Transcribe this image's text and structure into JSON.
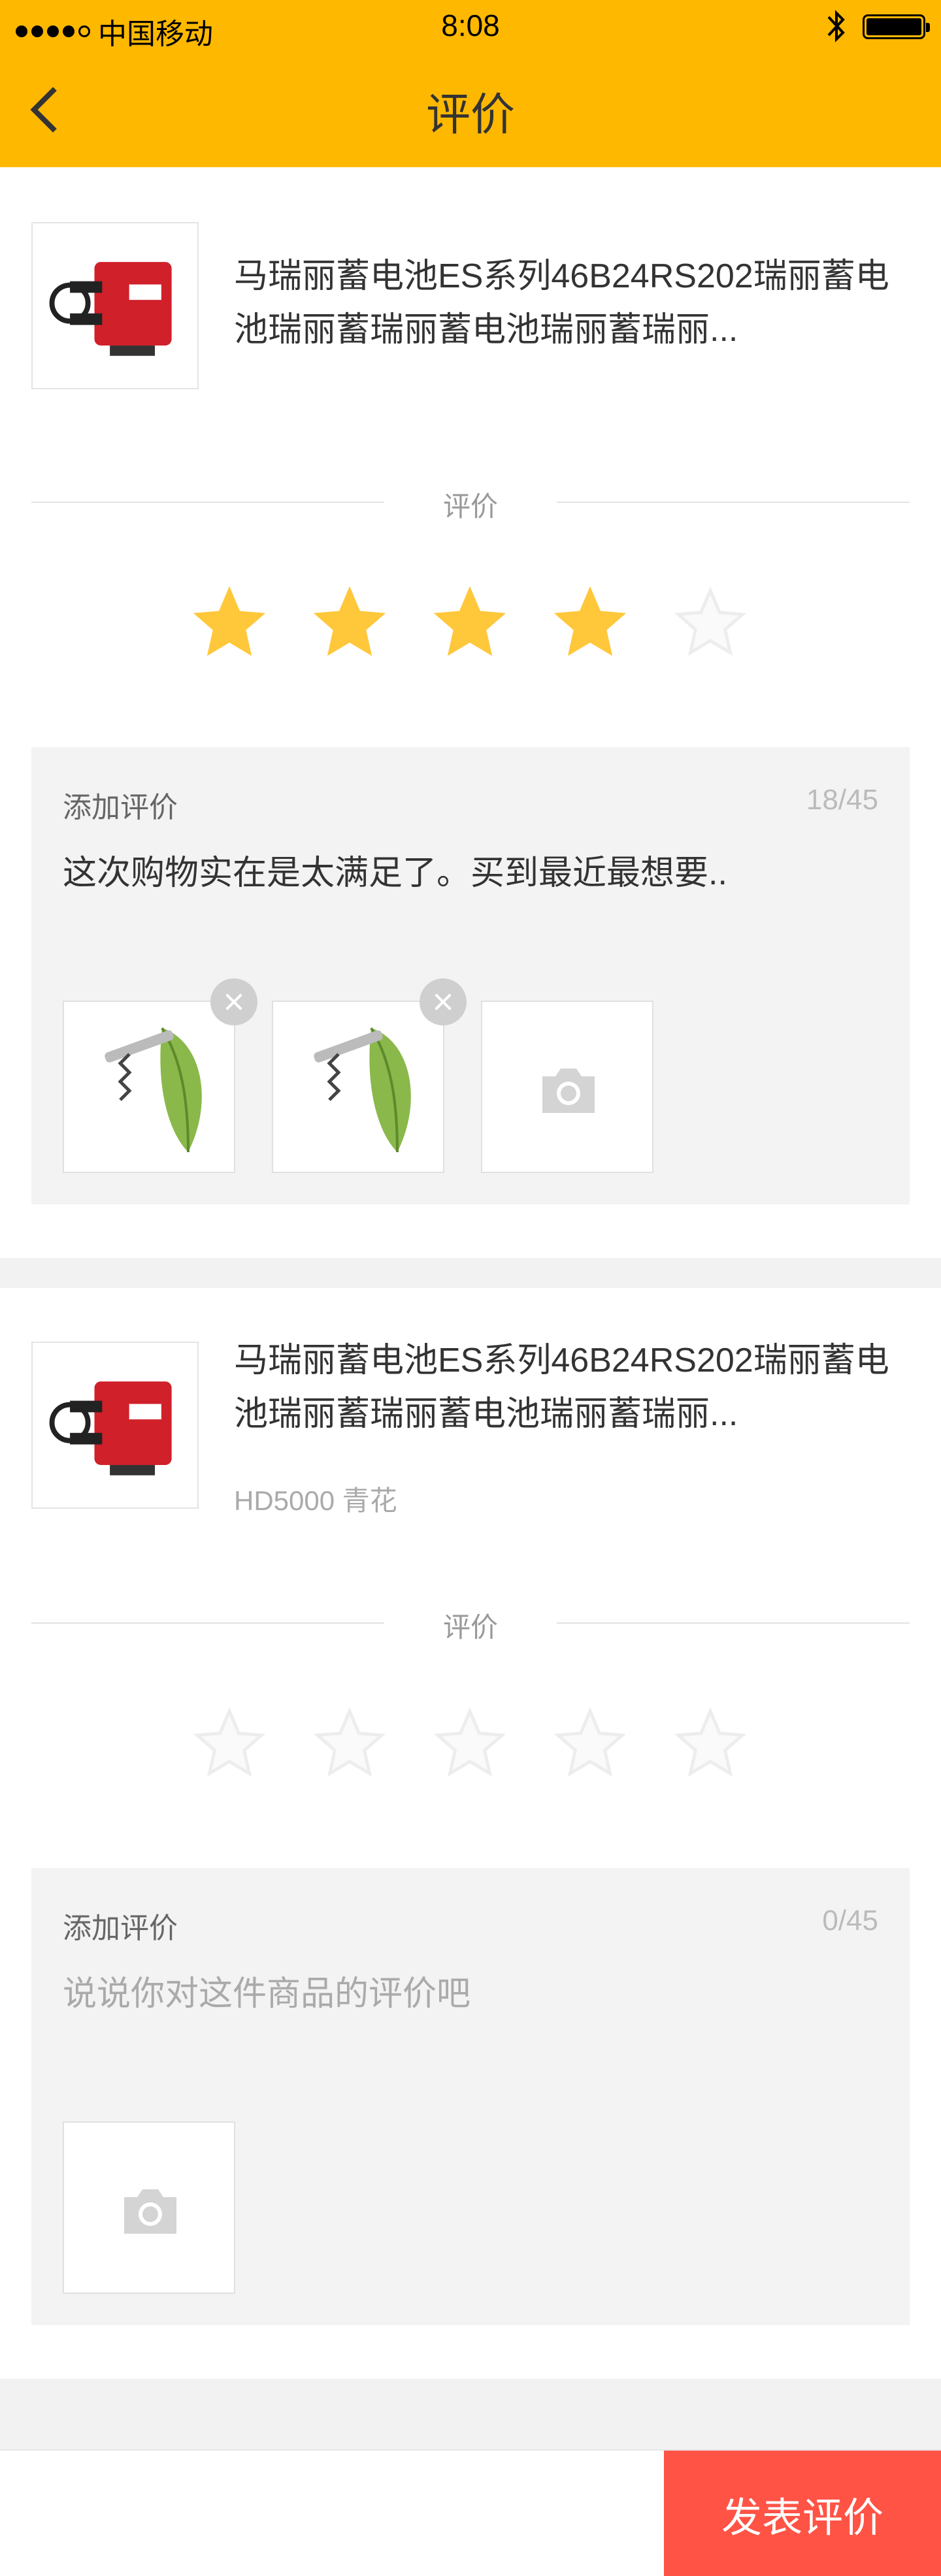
{
  "status_bar": {
    "carrier": "中国移动",
    "time": "8:08"
  },
  "nav": {
    "title": "评价",
    "back_icon": "chevron-left-icon"
  },
  "colors": {
    "header_bg": "#FFB800",
    "star_active": "#FFC73A",
    "star_inactive": "#EDEDED",
    "submit_bg": "#FF5346"
  },
  "items": [
    {
      "product_title": "马瑞丽蓄电池ES系列46B24RS202瑞丽蓄电池瑞丽蓄瑞丽蓄电池瑞丽蓄瑞丽...",
      "product_spec": "",
      "rating_label": "评价",
      "rating": 4,
      "rating_max": 5,
      "review_heading": "添加评价",
      "review_count": "18/45",
      "review_text": "这次购物实在是太满足了。买到最近最想要..",
      "review_placeholder": "说说你对这件商品的评价吧",
      "photos": [
        "corkscrew-photo",
        "corkscrew-photo"
      ]
    },
    {
      "product_title": "马瑞丽蓄电池ES系列46B24RS202瑞丽蓄电池瑞丽蓄瑞丽蓄电池瑞丽蓄瑞丽...",
      "product_spec": "HD5000 青花",
      "rating_label": "评价",
      "rating": 0,
      "rating_max": 5,
      "review_heading": "添加评价",
      "review_count": "0/45",
      "review_text": "",
      "review_placeholder": "说说你对这件商品的评价吧",
      "photos": []
    }
  ],
  "footer": {
    "submit_label": "发表评价"
  }
}
